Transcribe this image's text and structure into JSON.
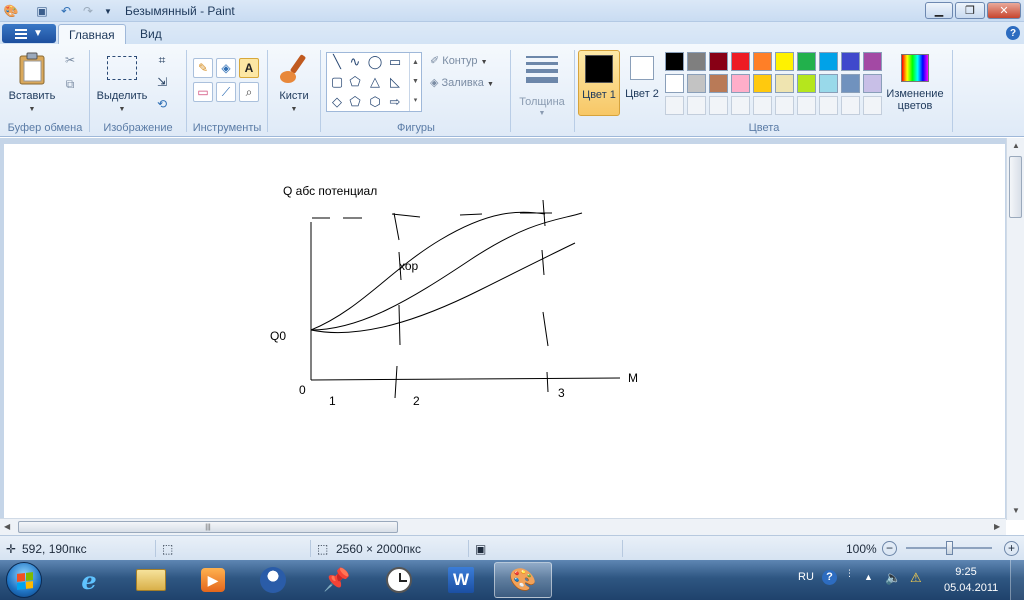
{
  "window": {
    "title": "Безымянный - Paint"
  },
  "tabs": {
    "home": "Главная",
    "view": "Вид"
  },
  "clipboard": {
    "paste": "Вставить",
    "label": "Буфер обмена"
  },
  "image": {
    "select": "Выделить",
    "label": "Изображение"
  },
  "tools": {
    "label": "Инструменты",
    "brushes": "Кисти"
  },
  "shapes": {
    "outline": "Контур",
    "fill": "Заливка",
    "label": "Фигуры"
  },
  "size": {
    "label": "Толщина"
  },
  "colors": {
    "color1_label": "Цвет 1",
    "color2_label": "Цвет 2",
    "edit_label": "Изменение цветов",
    "group_label": "Цвета",
    "color1": "#000000",
    "color2": "#ffffff",
    "palette_row1": [
      "#000000",
      "#7f7f7f",
      "#880015",
      "#ed1c24",
      "#ff7f27",
      "#fff200",
      "#22b14c",
      "#00a2e8",
      "#3f48cc",
      "#a349a4"
    ],
    "palette_row2": [
      "#ffffff",
      "#c3c3c3",
      "#b97a57",
      "#ffaec9",
      "#ffc90e",
      "#efe4b0",
      "#b5e61d",
      "#99d9ea",
      "#7092be",
      "#c8bfe7"
    ]
  },
  "drawing": {
    "y_axis_label": "Q абс потенциал",
    "curve_label": "хор",
    "q0": "Q0",
    "origin": "0",
    "x_axis_label": "М",
    "tick1": "1",
    "tick2": "2",
    "tick3": "3"
  },
  "status": {
    "cursor": "592, 190пкс",
    "canvas_size": "2560 × 2000пкс",
    "zoom": "100%"
  },
  "tray": {
    "lang": "RU",
    "time": "9:25",
    "date": "05.04.2011"
  }
}
